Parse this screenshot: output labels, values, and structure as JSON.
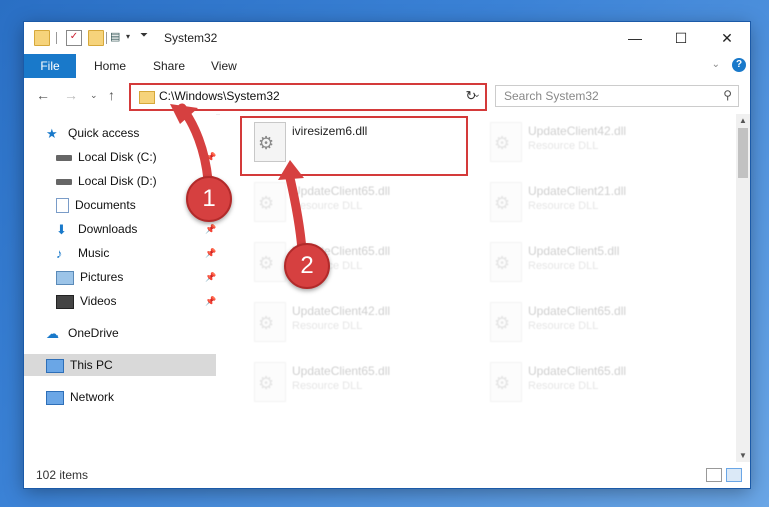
{
  "window": {
    "title": "System32"
  },
  "ribbon": {
    "tabs": [
      "File",
      "Home",
      "Share",
      "View"
    ]
  },
  "nav": {
    "address": "C:\\Windows\\System32",
    "search_placeholder": "Search System32"
  },
  "sidebar": {
    "items": [
      {
        "label": "Quick access",
        "icon": "star-icon",
        "pinned": false
      },
      {
        "label": "Local Disk (C:)",
        "icon": "drive-icon",
        "pinned": true
      },
      {
        "label": "Local Disk (D:)",
        "icon": "drive-icon",
        "pinned": true
      },
      {
        "label": "Documents",
        "icon": "documents-icon",
        "pinned": true
      },
      {
        "label": "Downloads",
        "icon": "download-icon",
        "pinned": true
      },
      {
        "label": "Music",
        "icon": "music-icon",
        "pinned": true
      },
      {
        "label": "Pictures",
        "icon": "pictures-icon",
        "pinned": true
      },
      {
        "label": "Videos",
        "icon": "videos-icon",
        "pinned": true
      },
      {
        "label": "OneDrive",
        "icon": "cloud-icon",
        "pinned": false
      },
      {
        "label": "This PC",
        "icon": "computer-icon",
        "pinned": false,
        "selected": true
      },
      {
        "label": "Network",
        "icon": "network-icon",
        "pinned": false
      }
    ]
  },
  "files": {
    "highlighted": {
      "name": "iviresizem6.dll",
      "type": ""
    },
    "faded": [
      {
        "name": "UpdateClient42.dll",
        "type": "Resource DLL"
      },
      {
        "name": "UpdateClient65.dll",
        "type": "Resource DLL"
      },
      {
        "name": "UpdateClient21.dll",
        "type": "Resource DLL"
      },
      {
        "name": "UpdateClient65.dll",
        "type": "Resource DLL"
      },
      {
        "name": "UpdateClient5.dll",
        "type": "Resource DLL"
      },
      {
        "name": "UpdateClient42.dll",
        "type": "Resource DLL"
      },
      {
        "name": "UpdateClient65.dll",
        "type": "Resource DLL"
      },
      {
        "name": "UpdateClient65.dll",
        "type": "Resource DLL"
      },
      {
        "name": "UpdateClient65.dll",
        "type": "Resource DLL"
      }
    ]
  },
  "status": {
    "item_count": "102 items"
  },
  "callouts": {
    "one": "1",
    "two": "2"
  },
  "colors": {
    "accent": "#1979ca",
    "callout": "#d64040",
    "highlight_border": "#d43a3a"
  }
}
